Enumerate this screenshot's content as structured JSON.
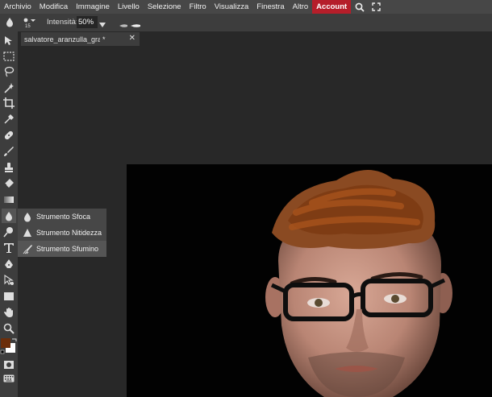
{
  "menubar": {
    "items": [
      "Archivio",
      "Modifica",
      "Immagine",
      "Livello",
      "Selezione",
      "Filtro",
      "Visualizza",
      "Finestra",
      "Altro",
      "Account"
    ],
    "icons": [
      "search-icon",
      "fullscreen-icon"
    ],
    "account_color": "#b51e2a"
  },
  "options": {
    "brush_size": "15",
    "intensity_label": "Intensità:",
    "intensity_value": "50%"
  },
  "tab": {
    "name": "salvatore_aranzulla_gra",
    "modified": "*",
    "close": "✕"
  },
  "tools_flyout": [
    {
      "label": "Strumento Sfoca",
      "icon": "blur-drop-icon"
    },
    {
      "label": "Strumento Nitidezza",
      "icon": "sharpen-triangle-icon"
    },
    {
      "label": "Strumento Sfumino",
      "icon": "smudge-finger-icon"
    }
  ],
  "colors": {
    "foreground": "#6b2e0b",
    "background": "#ffffff",
    "panel": "#3d3d3d",
    "menu": "#474747",
    "workspace": "#282828"
  }
}
